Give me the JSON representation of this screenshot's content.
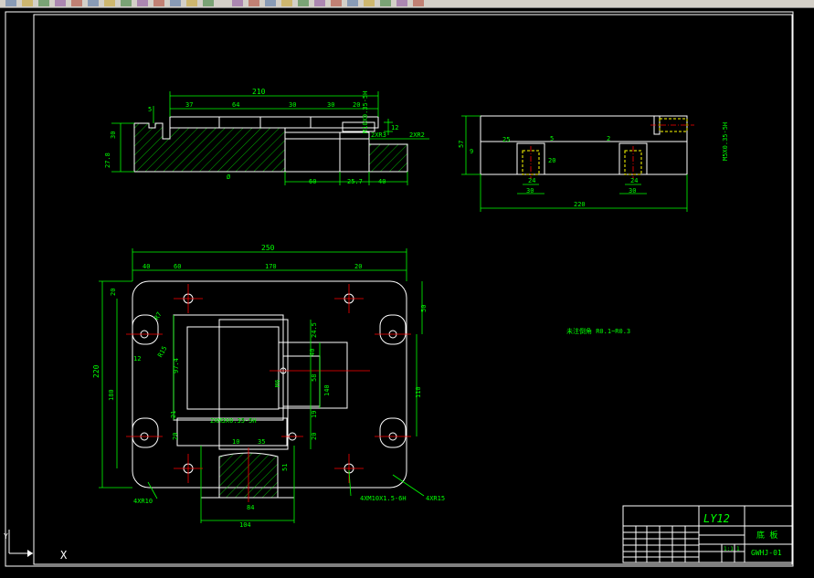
{
  "toolbar": {
    "icons": [
      "new-icon",
      "open-icon",
      "save-icon",
      "print-icon",
      "preview-icon",
      "cut-icon",
      "copy-icon",
      "paste-icon",
      "match-icon",
      "undo-icon",
      "redo-icon",
      "pan-icon",
      "zoom-realtime-icon",
      "zoom-window-icon",
      "zoom-previous-icon",
      "properties-icon",
      "design-center-icon",
      "tool-palette-icon",
      "sheet-set-icon",
      "markup-icon",
      "calculator-icon",
      "help-icon",
      "layer-icon",
      "layer-state-icon",
      "color-icon"
    ]
  },
  "colors": {
    "background": "#000000",
    "outline": "#ffffff",
    "dimension": "#00ff00",
    "center": "#ff0000",
    "hidden": "#ffff00"
  },
  "drawing": {
    "top_left_view": {
      "dims": {
        "overall_top": "210",
        "seg_a": "37",
        "seg_b": "64",
        "seg_c": "30",
        "seg_d": "30",
        "seg_e": "20",
        "side_5": "5",
        "side_30": "30",
        "side_27": "27.8",
        "bot_60": "60",
        "bot_25": "25.7",
        "bot_40": "40",
        "right_12": "12",
        "right_m": "M10X0.35-5H",
        "note_2x": "2XR2",
        "note_2x2": "2XR3",
        "phi": "Ø"
      }
    },
    "top_right_view": {
      "dims": {
        "total": "220",
        "h_57": "57",
        "h_9": "9",
        "h_5": "5",
        "h_25": "25",
        "w_24a": "24",
        "w_30a": "30",
        "w_24b": "24",
        "w_30b": "30",
        "h_20": "20",
        "h_2": "2",
        "side_note": "M5X0.35-5H"
      }
    },
    "plan_view": {
      "dims": {
        "top_250": "250",
        "top_40": "40",
        "top_60": "60",
        "top_170": "170",
        "top_20": "20",
        "left_220": "220",
        "left_180": "180",
        "left_20": "20",
        "left_r7": "R7",
        "left_12": "12",
        "left_r15": "R15",
        "left_974": "97.4",
        "left_21": "21",
        "left_20b": "20",
        "right_50": "50",
        "right_110": "110",
        "mid_245": "24.5",
        "mid_40": "40",
        "mid_58": "58",
        "mid_140": "140",
        "mid_19": "19",
        "mid_20": "20",
        "thread_left": "2XM3X0.35-5H",
        "thread_m6": "M6",
        "low_10": "10",
        "low_35": "35",
        "low_84": "84",
        "low_104": "104",
        "low_51": "51",
        "note_4xr10": "4XR10",
        "note_4xm10": "4XM10X1.5-6H",
        "note_4xr15": "4XR15"
      }
    },
    "note_text": "未注倒角 R0.1~R0.3"
  },
  "title_block": {
    "material": "LY12",
    "part_name": "底 板",
    "drawing_no": "GWHJ-01",
    "scale": "1:1",
    "qty": "1"
  },
  "ucs": {
    "y_label": "Y",
    "x_label": "X"
  }
}
